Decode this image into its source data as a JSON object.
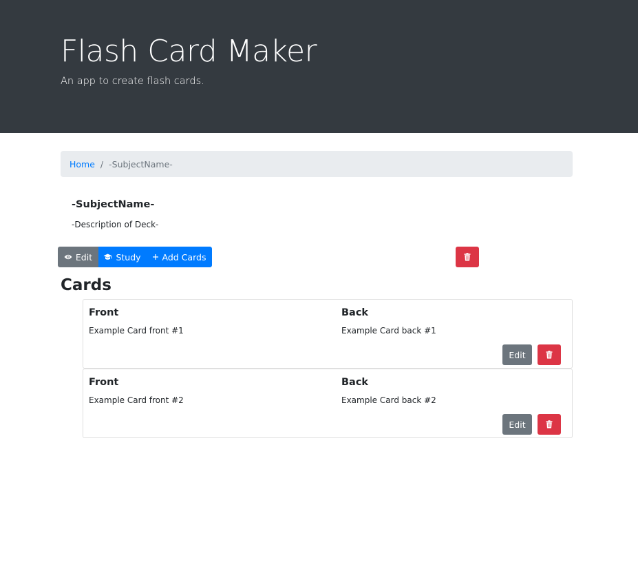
{
  "header": {
    "title": "Flash Card Maker",
    "subtitle": "An app to create flash cards."
  },
  "breadcrumb": {
    "home_label": "Home",
    "separator": "/",
    "current_label": "-SubjectName-"
  },
  "deck": {
    "name": "-SubjectName-",
    "description": "-Description of Deck-"
  },
  "toolbar": {
    "edit_label": "Edit",
    "study_label": "Study",
    "add_cards_label": "Add Cards",
    "delete_icon": "trash-icon"
  },
  "cards_section": {
    "heading": "Cards",
    "cards": [
      {
        "front_label": "Front",
        "front_text": "Example Card front #1",
        "back_label": "Back",
        "back_text": "Example Card back #1",
        "edit_label": "Edit"
      },
      {
        "front_label": "Front",
        "front_text": "Example Card front #2",
        "back_label": "Back",
        "back_text": "Example Card back #2",
        "edit_label": "Edit"
      }
    ]
  },
  "colors": {
    "header_bg": "#343a40",
    "primary": "#007bff",
    "secondary": "#6c757d",
    "danger": "#dc3545",
    "breadcrumb_bg": "#e9ecef"
  }
}
